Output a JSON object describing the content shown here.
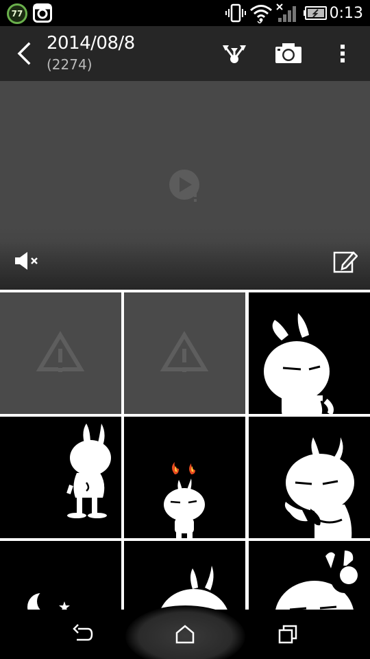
{
  "status_bar": {
    "notification_badge": "77",
    "time": "0:13",
    "icons": [
      "notification-badge-icon",
      "instagram-icon",
      "vibrate-icon",
      "wifi-icon",
      "no-signal-icon",
      "battery-charging-icon"
    ]
  },
  "action_bar": {
    "title": "2014/08/8",
    "subtitle": "(2274)",
    "icons": [
      "back-icon",
      "share-icon",
      "camera-icon",
      "overflow-menu-icon"
    ]
  },
  "video": {
    "icons": [
      "play-error-icon",
      "mute-icon",
      "edit-icon"
    ]
  },
  "grid": {
    "tiles": [
      {
        "kind": "broken"
      },
      {
        "kind": "broken"
      },
      {
        "kind": "sticker"
      },
      {
        "kind": "sticker"
      },
      {
        "kind": "sticker"
      },
      {
        "kind": "sticker"
      },
      {
        "kind": "sticker"
      },
      {
        "kind": "sticker"
      },
      {
        "kind": "sticker"
      }
    ]
  },
  "nav_bar": {
    "icons": [
      "back-nav-icon",
      "home-icon",
      "recent-apps-icon"
    ]
  },
  "colors": {
    "action_bar_bg": "#262626",
    "video_bg": "#484848",
    "broken_tile_bg": "#4a4a4a",
    "badge_green": "#6ab04c"
  }
}
